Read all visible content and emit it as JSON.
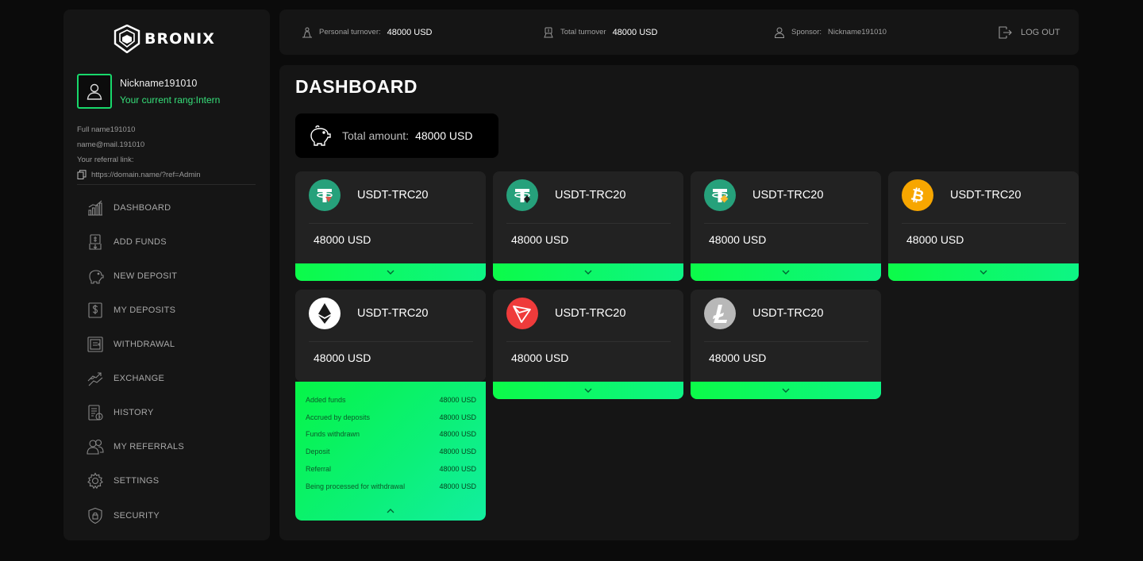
{
  "brand": {
    "name": "BRONIX"
  },
  "profile": {
    "nickname": "Nickname191010",
    "rang": "Your current rang:Intern",
    "full_name": "Full name191010",
    "email": "name@mail.191010",
    "referral_label": "Your referral link:",
    "referral_link": "https://domain.name/?ref=Admin"
  },
  "nav": {
    "items": [
      {
        "label": "DASHBOARD",
        "icon": "chart-icon"
      },
      {
        "label": "ADD FUNDS",
        "icon": "add-funds-icon"
      },
      {
        "label": "NEW DEPOSIT",
        "icon": "piggy-bank-icon"
      },
      {
        "label": "MY DEPOSITS",
        "icon": "dollar-icon"
      },
      {
        "label": "WITHDRAWAL",
        "icon": "wallet-icon"
      },
      {
        "label": "EXCHANGE",
        "icon": "exchange-icon"
      },
      {
        "label": "HISTORY",
        "icon": "history-icon"
      },
      {
        "label": "MY REFERRALS",
        "icon": "users-icon"
      },
      {
        "label": "SETTINGS",
        "icon": "gear-icon"
      },
      {
        "label": "SECURITY",
        "icon": "shield-icon"
      }
    ]
  },
  "topbar": {
    "personal_label": "Personal turnover:",
    "personal_value": "48000 USD",
    "total_label": "Total turnover",
    "total_value": "48000 USD",
    "sponsor_label": "Sponsor:",
    "sponsor_value": "Nickname191010",
    "logout_label": "LOG OUT"
  },
  "main": {
    "title": "DASHBOARD",
    "total_label": "Total amount:",
    "total_value": "48000 USD"
  },
  "cards": [
    {
      "name": "USDT-TRC20",
      "amount": "48000 USD",
      "coin": "tether-trc-icon"
    },
    {
      "name": "USDT-TRC20",
      "amount": "48000 USD",
      "coin": "tether-erc-icon"
    },
    {
      "name": "USDT-TRC20",
      "amount": "48000 USD",
      "coin": "tether-bep-icon"
    },
    {
      "name": "USDT-TRC20",
      "amount": "48000 USD",
      "coin": "bitcoin-icon"
    },
    {
      "name": "USDT-TRC20",
      "amount": "48000 USD",
      "coin": "ethereum-icon"
    },
    {
      "name": "USDT-TRC20",
      "amount": "48000 USD",
      "coin": "tron-icon"
    },
    {
      "name": "USDT-TRC20",
      "amount": "48000 USD",
      "coin": "litecoin-icon"
    }
  ],
  "details": [
    {
      "label": "Added funds",
      "value": "48000 USD"
    },
    {
      "label": "Accrued by deposits",
      "value": "48000 USD"
    },
    {
      "label": "Funds withdrawn",
      "value": "48000 USD"
    },
    {
      "label": "Deposit",
      "value": "48000 USD"
    },
    {
      "label": "Referral",
      "value": "48000 USD"
    },
    {
      "label": "Being processed for withdrawal",
      "value": "48000 USD"
    }
  ],
  "colors": {
    "accent": "#18d86b",
    "gradient_start": "#0cfb49",
    "gradient_end": "#0df585",
    "tether": "#26a17b",
    "bitcoin": "#f7a600",
    "tron": "#ef3b3b",
    "litecoin": "#b8b8b8"
  }
}
